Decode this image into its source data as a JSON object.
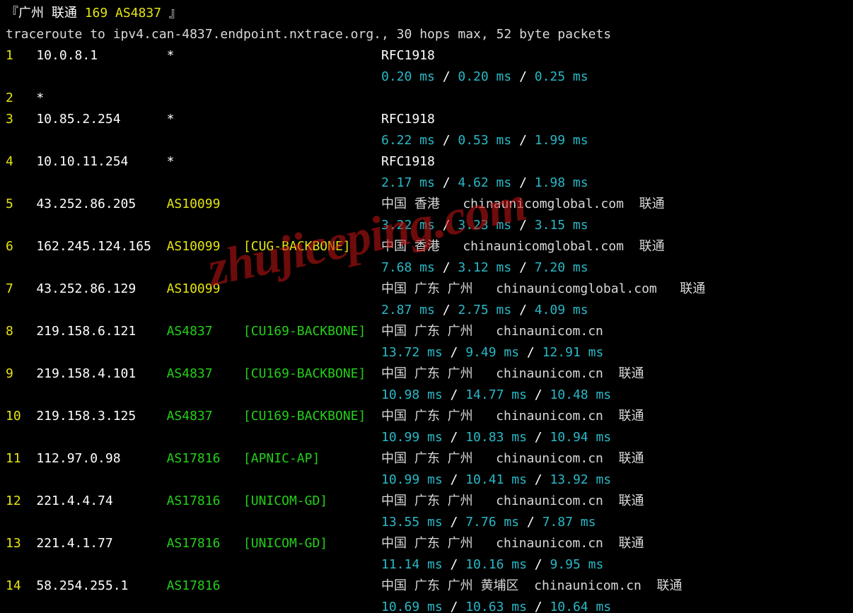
{
  "colors": {
    "white": "#ffffff",
    "yellow": "#e5e510",
    "green": "#23d018",
    "cyan": "#29b8c6",
    "bg": "#000000"
  },
  "header": {
    "bracket_open": "『",
    "title_prefix": "广州 联通 ",
    "title_highlight": "169 AS4837",
    "title_suffix": " ",
    "bracket_close": "』",
    "traceroute_line": "traceroute to ipv4.can-4837.endpoint.nxtrace.org., 30 hops max, 52 byte packets"
  },
  "watermark": "zhujiceping.com",
  "timing_sep": " / ",
  "hops": [
    {
      "n": "1",
      "ip": "10.0.8.1",
      "asn": "*",
      "asn_color": "white",
      "netname": "",
      "geo": "RFC1918",
      "geo_color": "white",
      "times": [
        "0.20 ms",
        "0.20 ms",
        "0.25 ms"
      ]
    },
    {
      "n": "2",
      "ip": "*",
      "asn": "",
      "asn_color": "white",
      "netname": "",
      "geo": "",
      "geo_color": "white",
      "times": []
    },
    {
      "n": "3",
      "ip": "10.85.2.254",
      "asn": "*",
      "asn_color": "white",
      "netname": "",
      "geo": "RFC1918",
      "geo_color": "white",
      "times": [
        "6.22 ms",
        "0.53 ms",
        "1.99 ms"
      ]
    },
    {
      "n": "4",
      "ip": "10.10.11.254",
      "asn": "*",
      "asn_color": "white",
      "netname": "",
      "geo": "RFC1918",
      "geo_color": "white",
      "times": [
        "2.17 ms",
        "4.62 ms",
        "1.98 ms"
      ]
    },
    {
      "n": "5",
      "ip": "43.252.86.205",
      "asn": "AS10099",
      "asn_color": "yellow",
      "netname": "",
      "geo": "中国 香港   chinaunicomglobal.com  联通",
      "geo_color": "grey",
      "times": [
        "3.22 ms",
        "3.23 ms",
        "3.15 ms"
      ]
    },
    {
      "n": "6",
      "ip": "162.245.124.165",
      "asn": "AS10099",
      "asn_color": "yellow",
      "netname": "[CUG-BACKBONE]",
      "net_color": "yellow",
      "geo": "中国 香港   chinaunicomglobal.com  联通",
      "geo_color": "grey",
      "times": [
        "7.68 ms",
        "3.12 ms",
        "7.20 ms"
      ]
    },
    {
      "n": "7",
      "ip": "43.252.86.129",
      "asn": "AS10099",
      "asn_color": "yellow",
      "netname": "",
      "geo": "中国 广东 广州   chinaunicomglobal.com   联通",
      "geo_color": "grey",
      "times": [
        "2.87 ms",
        "2.75 ms",
        "4.09 ms"
      ]
    },
    {
      "n": "8",
      "ip": "219.158.6.121",
      "asn": "AS4837",
      "asn_color": "green",
      "netname": "[CU169-BACKBONE]",
      "net_color": "green",
      "geo": "中国 广东 广州   chinaunicom.cn",
      "geo_color": "grey",
      "times": [
        "13.72 ms",
        "9.49 ms",
        "12.91 ms"
      ]
    },
    {
      "n": "9",
      "ip": "219.158.4.101",
      "asn": "AS4837",
      "asn_color": "green",
      "netname": "[CU169-BACKBONE]",
      "net_color": "green",
      "geo": "中国 广东 广州   chinaunicom.cn  联通",
      "geo_color": "grey",
      "times": [
        "10.98 ms",
        "14.77 ms",
        "10.48 ms"
      ]
    },
    {
      "n": "10",
      "ip": "219.158.3.125",
      "asn": "AS4837",
      "asn_color": "green",
      "netname": "[CU169-BACKBONE]",
      "net_color": "green",
      "geo": "中国 广东 广州   chinaunicom.cn  联通",
      "geo_color": "grey",
      "times": [
        "10.99 ms",
        "10.83 ms",
        "10.94 ms"
      ]
    },
    {
      "n": "11",
      "ip": "112.97.0.98",
      "asn": "AS17816",
      "asn_color": "green",
      "netname": "[APNIC-AP]",
      "net_color": "green",
      "geo": "中国 广东 广州   chinaunicom.cn  联通",
      "geo_color": "grey",
      "times": [
        "10.99 ms",
        "10.41 ms",
        "13.92 ms"
      ]
    },
    {
      "n": "12",
      "ip": "221.4.4.74",
      "asn": "AS17816",
      "asn_color": "green",
      "netname": "[UNICOM-GD]",
      "net_color": "green",
      "geo": "中国 广东 广州   chinaunicom.cn  联通",
      "geo_color": "grey",
      "times": [
        "13.55 ms",
        "7.76 ms",
        "7.87 ms"
      ]
    },
    {
      "n": "13",
      "ip": "221.4.1.77",
      "asn": "AS17816",
      "asn_color": "green",
      "netname": "[UNICOM-GD]",
      "net_color": "green",
      "geo": "中国 广东 广州   chinaunicom.cn  联通",
      "geo_color": "grey",
      "times": [
        "11.14 ms",
        "10.16 ms",
        "9.95 ms"
      ]
    },
    {
      "n": "14",
      "ip": "58.254.255.1",
      "asn": "AS17816",
      "asn_color": "green",
      "netname": "",
      "geo": "中国 广东 广州 黄埔区  chinaunicom.cn  联通",
      "geo_color": "grey",
      "times": [
        "10.69 ms",
        "10.63 ms",
        "10.64 ms"
      ]
    }
  ]
}
